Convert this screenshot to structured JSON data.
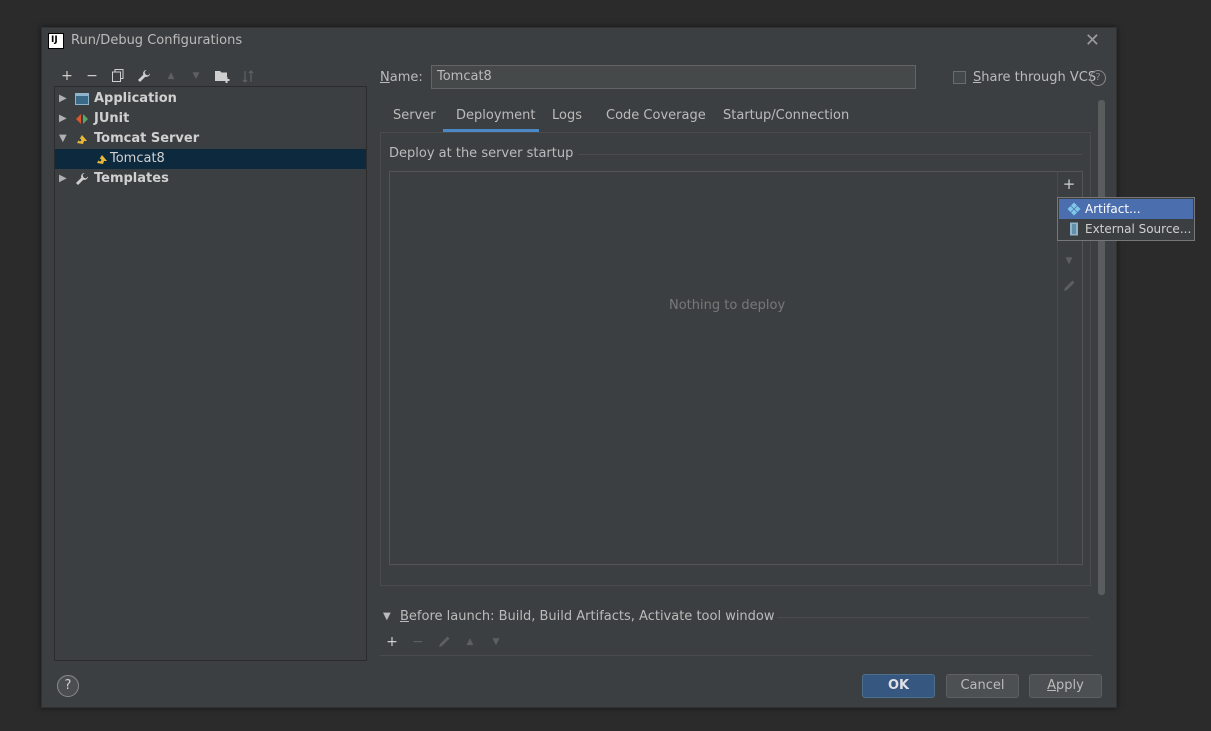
{
  "window": {
    "title": "Run/Debug Configurations",
    "app_icon": "intellij-icon",
    "close_glyph": "✕"
  },
  "toolbar": {
    "add": "+",
    "remove": "−",
    "copy": "⧉",
    "edit_defaults": "🔧",
    "move_up": "▲",
    "move_down": "▼",
    "new_folder": "▆",
    "sort": "↓"
  },
  "tree": {
    "items": [
      {
        "label": "Application",
        "expanded": false,
        "icon": "application-icon"
      },
      {
        "label": "JUnit",
        "expanded": false,
        "icon": "junit-icon"
      },
      {
        "label": "Tomcat Server",
        "expanded": true,
        "icon": "tomcat-icon"
      },
      {
        "label": "Tomcat8",
        "selected": true,
        "icon": "tomcat-icon"
      },
      {
        "label": "Templates",
        "expanded": false,
        "icon": "wrench-icon"
      }
    ]
  },
  "name_field": {
    "label_first": "N",
    "label_rest": "ame:",
    "value": "Tomcat8"
  },
  "share_vcs": {
    "label_first": "S",
    "label_rest": "hare through VCS",
    "checked": false
  },
  "tabs": [
    "Server",
    "Deployment",
    "Logs",
    "Code Coverage",
    "Startup/Connection"
  ],
  "active_tab": "Deployment",
  "deployment": {
    "section_title": "Deploy at the server startup",
    "empty_text": "Nothing to deploy",
    "side_add": "+"
  },
  "popup_menu": {
    "items": [
      {
        "label": "Artifact...",
        "icon": "artifact-icon",
        "selected": true
      },
      {
        "label": "External Source...",
        "icon": "external-source-icon",
        "selected": false
      }
    ]
  },
  "before_launch": {
    "label_first": "B",
    "label_rest": "efore launch: Build, Build Artifacts, Activate tool window",
    "add": "+",
    "remove": "−"
  },
  "buttons": {
    "help": "?",
    "ok": "OK",
    "cancel": "Cancel",
    "apply_first": "A",
    "apply_rest": "pply"
  },
  "colors": {
    "accent": "#4a88c7",
    "selection": "#0d293e",
    "popup_selection": "#4b6eaf",
    "primary_button": "#365880"
  }
}
